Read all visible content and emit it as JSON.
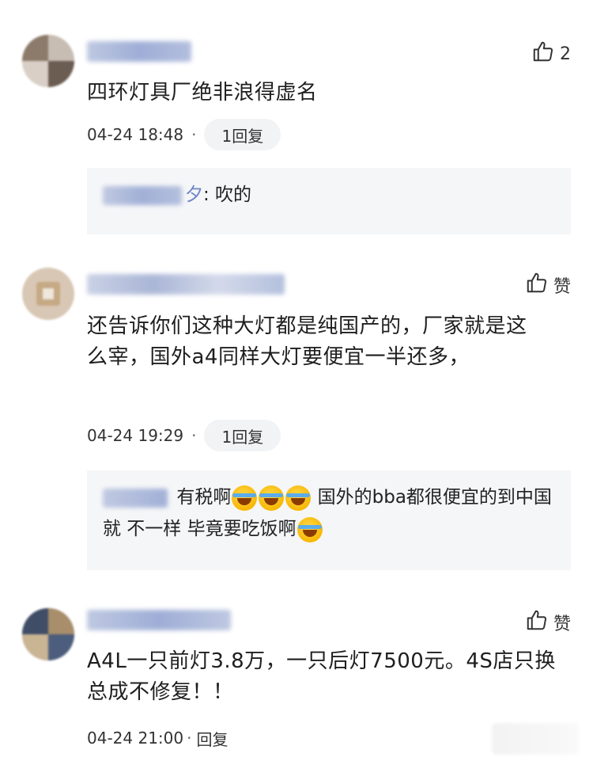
{
  "comments": [
    {
      "username": "",
      "text": "四环灯具厂绝非浪得虚名",
      "like_count": "2",
      "timestamp": "04-24 18:48",
      "separator": "·",
      "reply_count": "1回复",
      "subreply": {
        "username_suffix": "夕",
        "text": ": 吹的"
      }
    },
    {
      "username": "",
      "text": "还告诉你们这种大灯都是纯国产的，厂家就是这么宰，国外a4同样大灯要便宜一半还多，",
      "like_label": "赞",
      "timestamp": "04-24 19:29",
      "separator": "·",
      "reply_count": "1回复",
      "subreply": {
        "text_before": "有税啊",
        "text_middle": "国外的bba都很便宜的到中国就 不一样 毕竟要吃饭啊"
      }
    },
    {
      "username": "",
      "text": "A4L一只前灯3.8万，一只后灯7500元。4S店只换总成不修复！！",
      "like_label": "赞",
      "timestamp": "04-24 21:00",
      "separator": "·",
      "reply_label": "回复"
    }
  ],
  "icons": {
    "like": "thumbs-up-icon",
    "emoji": "laugh-cry-emoji-icon"
  },
  "colors": {
    "pill_bg": "#f2f3f5",
    "subreply_bg": "#f5f6f8",
    "username_blur": "#6f86c7"
  }
}
